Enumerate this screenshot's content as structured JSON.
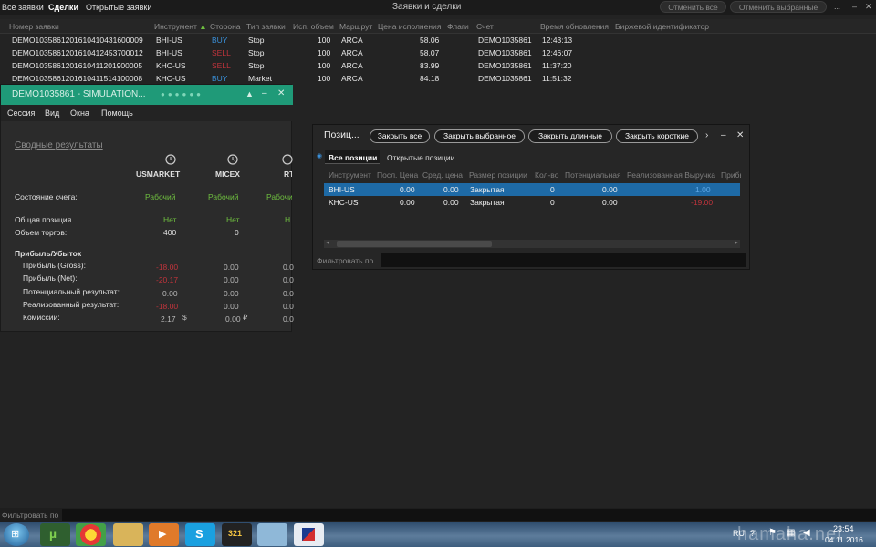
{
  "top": {
    "tabs": [
      "Все заявки",
      "Сделки",
      "Открытые заявки"
    ],
    "title": "Заявки и сделки",
    "btn_cancel_all": "Отменить все",
    "btn_cancel_selected": "Отменить выбранные",
    "more": "..."
  },
  "orders": {
    "headers": [
      "Номер заявки",
      "Инструмент",
      "Сторона",
      "Тип заявки",
      "Исп. объем",
      "Маршрут",
      "Цена исполнения",
      "Флаги",
      "Счет",
      "Время обновления",
      "Биржевой идентификатор"
    ],
    "rows": [
      {
        "id": "DEMO1035861201610410431600009",
        "inst": "BHI-US",
        "side": "BUY",
        "type": "Stop",
        "vol": "100",
        "route": "ARCA",
        "price": "58.06",
        "acct": "DEMO1035861",
        "time": "12:43:13"
      },
      {
        "id": "DEMO1035861201610412453700012",
        "inst": "BHI-US",
        "side": "SELL",
        "type": "Stop",
        "vol": "100",
        "route": "ARCA",
        "price": "58.07",
        "acct": "DEMO1035861",
        "time": "12:46:07"
      },
      {
        "id": "DEMO1035861201610411201900005",
        "inst": "KHC-US",
        "side": "SELL",
        "type": "Stop",
        "vol": "100",
        "route": "ARCA",
        "price": "83.99",
        "acct": "DEMO1035861",
        "time": "11:37:20"
      },
      {
        "id": "DEMO1035861201610411514100008",
        "inst": "KHC-US",
        "side": "BUY",
        "type": "Market",
        "vol": "100",
        "route": "ARCA",
        "price": "84.18",
        "acct": "DEMO1035861",
        "time": "11:51:32"
      }
    ]
  },
  "sim": {
    "title": "DEMO1035861 - SIMULATION...",
    "menu": [
      "Сессия",
      "Вид",
      "Окна",
      "Помощь"
    ],
    "summary_link": "Сводные результаты",
    "markets": [
      "USMARKET",
      "MICEX",
      "RT"
    ],
    "account_state_label": "Состояние счета:",
    "account_state": [
      "Рабочий",
      "Рабочий",
      "Рабочий"
    ],
    "total_position_label": "Общая позиция",
    "total_position": [
      "Нет",
      "Нет",
      "Н"
    ],
    "volume_label": "Объем торгов:",
    "volume": [
      "400",
      "0"
    ],
    "pl_header": "Прибыль/Убыток",
    "rows": [
      {
        "label": "Прибыль (Gross):",
        "us": "-18.00",
        "micex": "0.00",
        "rt": "0.0"
      },
      {
        "label": "Прибыль (Net):",
        "us": "-20.17",
        "micex": "0.00",
        "rt": "0.0"
      },
      {
        "label": "Потенциальный результат:",
        "us": "0.00",
        "micex": "0.00",
        "rt": "0.0"
      },
      {
        "label": "Реализованный результат:",
        "us": "-18.00",
        "micex": "0.00",
        "rt": "0.0"
      },
      {
        "label": "Комиссии:",
        "us": "2.17",
        "micex": "0.00",
        "rt": "0.0"
      }
    ],
    "currency_us": "$",
    "currency_rub": "₽"
  },
  "positions": {
    "title": "Позиц...",
    "buttons": [
      "Закрыть все",
      "Закрыть выбранное",
      "Закрыть длинные",
      "Закрыть короткие"
    ],
    "tabs": [
      "Все позиции",
      "Открытые позиции"
    ],
    "headers": [
      "Инструмент",
      "Посл. Цена",
      "Сред. цена",
      "Размер позиции",
      "Кол-во",
      "Потенциальная",
      "Реализованная Выручка",
      "Прибы"
    ],
    "rows": [
      {
        "inst": "BHI-US",
        "last": "0.00",
        "avg": "0.00",
        "size": "Закрытая",
        "qty": "0",
        "pot": "0.00",
        "real": "1.00",
        "selected": true
      },
      {
        "inst": "KHC-US",
        "last": "0.00",
        "avg": "0.00",
        "size": "Закрытая",
        "qty": "0",
        "pot": "0.00",
        "real": "-19.00",
        "selected": false
      }
    ],
    "filter_label": "Фильтровать по"
  },
  "bottom": {
    "filter_label": "Фильтровать по"
  },
  "tray": {
    "lang": "RU",
    "time": "23:54",
    "date": "04.11.2016",
    "watermark": "hamaha.net"
  },
  "colors": {
    "accent_green": "#6fbf3f",
    "buy_blue": "#3a8fd8",
    "sell_red": "#c0343c",
    "sim_header": "#1f9a78",
    "selected_row": "#1e6aa6"
  }
}
